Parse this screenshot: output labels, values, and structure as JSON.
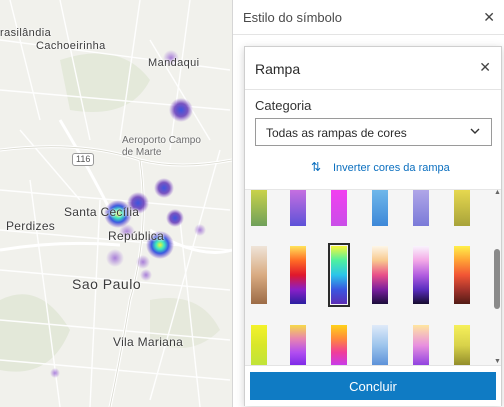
{
  "map": {
    "labels": {
      "brasilandia": "rasilândia",
      "cachoeirinha": "Cachoeirinha",
      "mandaqui": "Mandaqui",
      "airport": "Aeroporto Campo\nde Marte",
      "santa_cecilia": "Santa Cecília",
      "perdizes": "Perdizes",
      "republica": "República",
      "sao_paulo": "Sao Paulo",
      "vila_mariana": "Vila Mariana",
      "road_116": "116"
    },
    "colors": {
      "background": "#f1f1ec",
      "road": "#ffffff",
      "park": "#dfe6d2",
      "heat": "#7b3fc4"
    }
  },
  "side_panel": {
    "title": "Estilo do símbolo",
    "close_icon": "close-icon"
  },
  "popover": {
    "title": "Rampa",
    "close_icon": "close-icon",
    "category_label": "Categoria",
    "category_value": "Todas as rampas de cores",
    "invert_label": "Inverter cores da rampa",
    "invert_icon": "swap-vertical-icon",
    "done_label": "Concluir",
    "accent_color": "#0f7bc4",
    "ramps": [
      {
        "name": "ramp-r1c1",
        "colors": [
          "#c9d24a",
          "#6fa05a"
        ]
      },
      {
        "name": "ramp-r1c2",
        "colors": [
          "#c56fe0",
          "#5d52d8"
        ]
      },
      {
        "name": "ramp-r1c3",
        "colors": [
          "#f23ff0",
          "#c94ee8"
        ]
      },
      {
        "name": "ramp-r1c4",
        "colors": [
          "#6fb7ea",
          "#3d88d8"
        ]
      },
      {
        "name": "ramp-r1c5",
        "colors": [
          "#b0a6e8",
          "#7a7ad8"
        ]
      },
      {
        "name": "ramp-r1c6",
        "colors": [
          "#e6d84f",
          "#a8a33a"
        ]
      },
      {
        "name": "ramp-r2c1",
        "colors": [
          "#efe4d8",
          "#d9ab82",
          "#9c6b46"
        ]
      },
      {
        "name": "ramp-r2c2",
        "colors": [
          "#ffe35a",
          "#ff6b25",
          "#e0172c",
          "#8a1fc8",
          "#2a1fa0"
        ]
      },
      {
        "name": "ramp-r2c3",
        "colors": [
          "#f8f73a",
          "#4ef0a0",
          "#2bc4ea",
          "#3a56e0",
          "#5b2db5"
        ],
        "selected": true
      },
      {
        "name": "ramp-r2c4",
        "colors": [
          "#fdf6e8",
          "#f8c98e",
          "#e94f8a",
          "#7a1f9e",
          "#1a0d3a"
        ]
      },
      {
        "name": "ramp-r2c5",
        "colors": [
          "#f9f4fd",
          "#f3a8e6",
          "#b35ee0",
          "#5a2ec0",
          "#150b2e"
        ]
      },
      {
        "name": "ramp-r2c6",
        "colors": [
          "#fff04a",
          "#ffa135",
          "#f25535",
          "#a4332b",
          "#521b15"
        ]
      },
      {
        "name": "ramp-r3c1",
        "colors": [
          "#f4f22a",
          "#d8e62a",
          "#bfe43a"
        ]
      },
      {
        "name": "ramp-r3c2",
        "colors": [
          "#f6d94a",
          "#e884b0",
          "#b24ef0",
          "#7a28e8"
        ]
      },
      {
        "name": "ramp-r3c3",
        "colors": [
          "#ffd21a",
          "#ff8a3b",
          "#f03d9a",
          "#c53cf0"
        ]
      },
      {
        "name": "ramp-r3c4",
        "colors": [
          "#dfeaf9",
          "#9cc4ec",
          "#5a8fd8"
        ]
      },
      {
        "name": "ramp-r3c5",
        "colors": [
          "#ffe6a1",
          "#e88fdf",
          "#8c3fe0"
        ]
      },
      {
        "name": "ramp-r3c6",
        "colors": [
          "#f6f05a",
          "#d8d24a",
          "#8f8a2a"
        ]
      }
    ]
  }
}
